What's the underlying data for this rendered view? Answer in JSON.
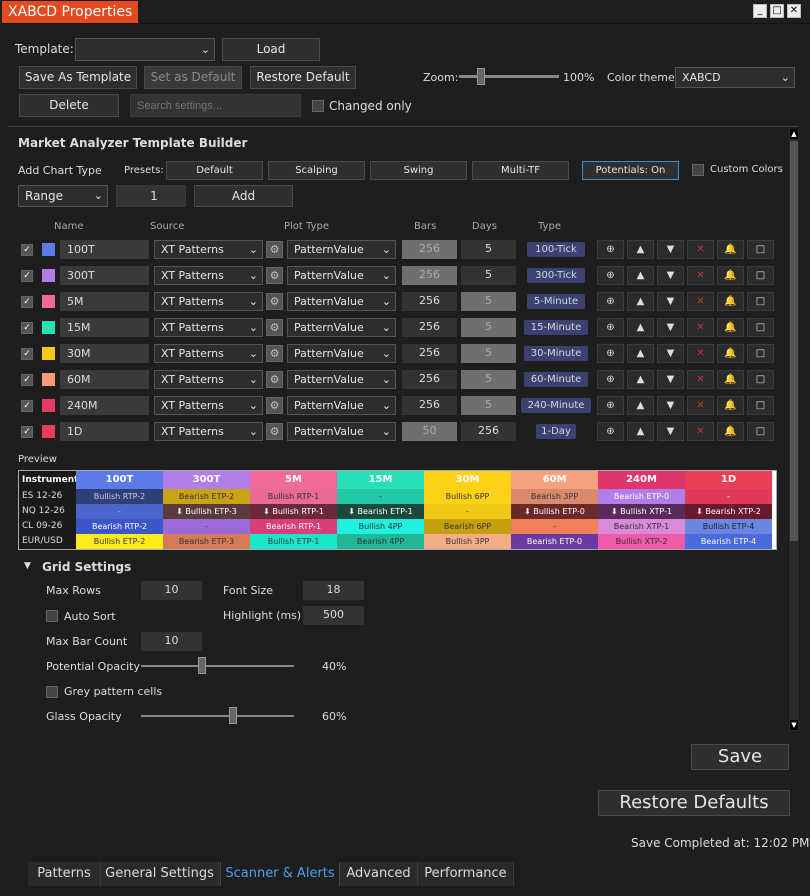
{
  "window": {
    "title": "XABCD Properties",
    "min": "_",
    "max": "□",
    "close": "✕"
  },
  "top": {
    "template_label": "Template:",
    "template_value": "",
    "load": "Load",
    "save_as_template": "Save As Template",
    "set_as_default": "Set as Default",
    "restore_default": "Restore Default",
    "delete": "Delete",
    "search_placeholder": "Search settings...",
    "changed_only": "Changed only",
    "zoom_label": "Zoom:",
    "zoom_value": "100%",
    "color_theme_label": "Color theme:",
    "color_theme_value": "XABCD"
  },
  "builder": {
    "title": "Market Analyzer Template Builder",
    "add_chart_type": "Add Chart Type",
    "presets_label": "Presets:",
    "presets": [
      "Default",
      "Scalping",
      "Swing",
      "Multi-TF",
      "Potentials: On"
    ],
    "custom_colors": "Custom Colors",
    "range_value": "Range",
    "count_value": "1",
    "add": "Add"
  },
  "columns": {
    "name": "Name",
    "source": "Source",
    "plot_type": "Plot Type",
    "bars": "Bars",
    "days": "Days",
    "type": "Type"
  },
  "row_buttons": {
    "target": "⊕",
    "up": "▲",
    "down": "▼",
    "del": "✕",
    "bell": "🔔",
    "box": "□"
  },
  "rows": [
    {
      "name": "100T",
      "color": "#5b7be8",
      "source": "XT Patterns",
      "plot": "PatternValue",
      "bars": "256",
      "days": "5",
      "type": "100-Tick",
      "bars_grey": true,
      "days_grey": false
    },
    {
      "name": "300T",
      "color": "#b07ee6",
      "source": "XT Patterns",
      "plot": "PatternValue",
      "bars": "256",
      "days": "5",
      "type": "300-Tick",
      "bars_grey": true,
      "days_grey": false
    },
    {
      "name": "5M",
      "color": "#f06a9a",
      "source": "XT Patterns",
      "plot": "PatternValue",
      "bars": "256",
      "days": "5",
      "type": "5-Minute",
      "bars_grey": false,
      "days_grey": true
    },
    {
      "name": "15M",
      "color": "#27e0b8",
      "source": "XT Patterns",
      "plot": "PatternValue",
      "bars": "256",
      "days": "5",
      "type": "15-Minute",
      "bars_grey": false,
      "days_grey": true
    },
    {
      "name": "30M",
      "color": "#f7c81c",
      "source": "XT Patterns",
      "plot": "PatternValue",
      "bars": "256",
      "days": "5",
      "type": "30-Minute",
      "bars_grey": false,
      "days_grey": true
    },
    {
      "name": "60M",
      "color": "#f59a7a",
      "source": "XT Patterns",
      "plot": "PatternValue",
      "bars": "256",
      "days": "5",
      "type": "60-Minute",
      "bars_grey": false,
      "days_grey": true
    },
    {
      "name": "240M",
      "color": "#e33a6a",
      "source": "XT Patterns",
      "plot": "PatternValue",
      "bars": "256",
      "days": "5",
      "type": "240-Minute",
      "bars_grey": false,
      "days_grey": true
    },
    {
      "name": "1D",
      "color": "#e83c5a",
      "source": "XT Patterns",
      "plot": "PatternValue",
      "bars": "50",
      "days": "256",
      "type": "1-Day",
      "bars_grey": true,
      "days_grey": false
    }
  ],
  "preview": {
    "label": "Preview",
    "instrument_header": "Instrument",
    "headers": [
      {
        "t": "100T",
        "bg": "#5b7be8"
      },
      {
        "t": "300T",
        "bg": "#b07ee6"
      },
      {
        "t": "5M",
        "bg": "#f06a9a"
      },
      {
        "t": "15M",
        "bg": "#27e0b8"
      },
      {
        "t": "30M",
        "bg": "#ffd21a"
      },
      {
        "t": "60M",
        "bg": "#f5a07e"
      },
      {
        "t": "240M",
        "bg": "#e0356a"
      },
      {
        "t": "1D",
        "bg": "#ea3f58"
      }
    ],
    "rows": [
      {
        "inst": "ES 12-26",
        "cells": [
          {
            "t": "Bullish RTP-2",
            "bg": "#2f3f7a",
            "fg": "#ccd"
          },
          {
            "t": "Bearish ETP-2",
            "bg": "#c9a316",
            "fg": "#333"
          },
          {
            "t": "Bullish RTP-1",
            "bg": "#e86a95",
            "fg": "#333"
          },
          {
            "t": "-",
            "bg": "#22c9a4",
            "fg": "#333"
          },
          {
            "t": "Bullish 6PP",
            "bg": "#ffd21a",
            "fg": "#333"
          },
          {
            "t": "Bearish 3PP",
            "bg": "#d98a6e",
            "fg": "#333"
          },
          {
            "t": "Bearish ETP-0",
            "bg": "#b07ee6",
            "fg": "#fff"
          },
          {
            "t": "-",
            "bg": "#e03a58",
            "fg": "#fff"
          }
        ]
      },
      {
        "inst": "NQ 12-26",
        "cells": [
          {
            "t": "-",
            "bg": "#4a66cc",
            "fg": "#ccd"
          },
          {
            "t": "⬇ Bullish ETP-3",
            "bg": "#5a3a3a",
            "fg": "#fff"
          },
          {
            "t": "⬇ Bullish RTP-1",
            "bg": "#6a2a3a",
            "fg": "#fff"
          },
          {
            "t": "⬇ Bearish ETP-1",
            "bg": "#1a4a3e",
            "fg": "#fff"
          },
          {
            "t": "-",
            "bg": "#f0c818",
            "fg": "#333"
          },
          {
            "t": "⬇ Bullish ETP-0",
            "bg": "#6a2a2a",
            "fg": "#fff"
          },
          {
            "t": "⬇ Bullish XTP-1",
            "bg": "#5a2a5a",
            "fg": "#fff"
          },
          {
            "t": "⬇ Bearish XTP-2",
            "bg": "#6a1a2a",
            "fg": "#fff"
          }
        ]
      },
      {
        "inst": "CL 09-26",
        "cells": [
          {
            "t": "Bearish RTP-2",
            "bg": "#3a56c8",
            "fg": "#fff"
          },
          {
            "t": "-",
            "bg": "#9c6ad6",
            "fg": "#333"
          },
          {
            "t": "Bearish RTP-1",
            "bg": "#d83e7a",
            "fg": "#fff"
          },
          {
            "t": "Bullish 4PP",
            "bg": "#1ff0e0",
            "fg": "#333"
          },
          {
            "t": "Bearish 6PP",
            "bg": "#c4a010",
            "fg": "#333"
          },
          {
            "t": "-",
            "bg": "#f0805a",
            "fg": "#333"
          },
          {
            "t": "Bearish XTP-1",
            "bg": "#d98ad8",
            "fg": "#333"
          },
          {
            "t": "Bullish ETP-4",
            "bg": "#6a86e0",
            "fg": "#222"
          }
        ]
      },
      {
        "inst": "EUR/USD",
        "cells": [
          {
            "t": "Bullish ETP-2",
            "bg": "#ffea1a",
            "fg": "#333"
          },
          {
            "t": "Bearish ETP-3",
            "bg": "#d77a5a",
            "fg": "#333"
          },
          {
            "t": "Bullish ETP-1",
            "bg": "#18e8c8",
            "fg": "#333"
          },
          {
            "t": "Bearish 4PP",
            "bg": "#20b896",
            "fg": "#333"
          },
          {
            "t": "Bullish 3PP",
            "bg": "#f5ad86",
            "fg": "#333"
          },
          {
            "t": "Bearish ETP-0",
            "bg": "#6a3aa0",
            "fg": "#fff"
          },
          {
            "t": "Bullish XTP-2",
            "bg": "#f05aa8",
            "fg": "#333"
          },
          {
            "t": "Bearish ETP-4",
            "bg": "#4a6ae0",
            "fg": "#fff"
          }
        ]
      }
    ]
  },
  "grid": {
    "title": "Grid Settings",
    "max_rows_label": "Max Rows",
    "max_rows": "10",
    "font_size_label": "Font Size",
    "font_size": "18",
    "auto_sort": "Auto Sort",
    "highlight_label": "Highlight (ms)",
    "highlight": "500",
    "max_bar_count_label": "Max Bar Count",
    "max_bar_count": "10",
    "potential_opacity_label": "Potential Opacity",
    "potential_opacity": "40%",
    "potential_opacity_level": 0.4,
    "grey_cells": "Grey pattern cells",
    "glass_opacity_label": "Glass Opacity",
    "glass_opacity": "60%",
    "glass_opacity_level": 0.6
  },
  "footer": {
    "save": "Save",
    "restore_defaults": "Restore Defaults",
    "status": "Save Completed at: 12:02 PM"
  },
  "tabs": [
    "Patterns",
    "General Settings",
    "Scanner & Alerts",
    "Advanced",
    "Performance"
  ],
  "active_tab": "Scanner & Alerts"
}
